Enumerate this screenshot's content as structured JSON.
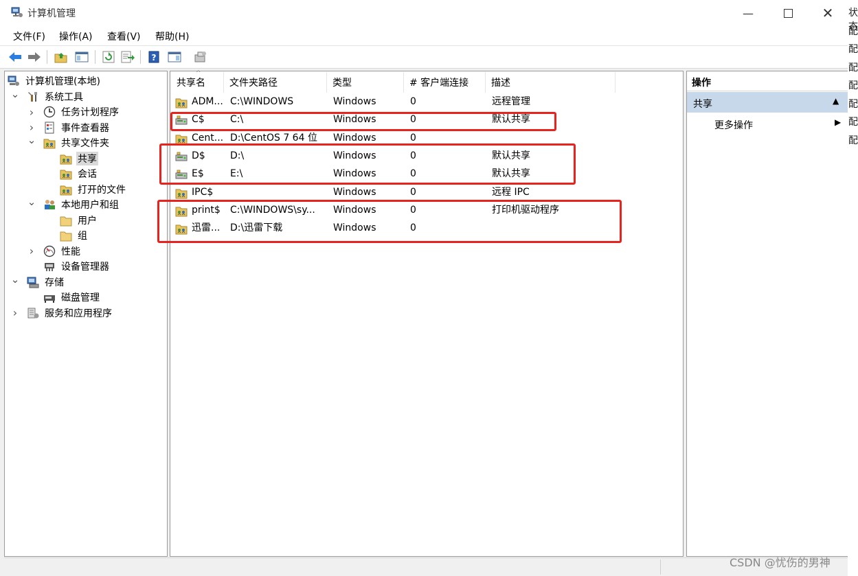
{
  "window": {
    "title": "计算机管理"
  },
  "menu": [
    "文件(F)",
    "操作(A)",
    "查看(V)",
    "帮助(H)"
  ],
  "tree": [
    {
      "label": "计算机管理(本地)",
      "level": 0,
      "toggle": "",
      "icon": "computer-management-icon"
    },
    {
      "label": "系统工具",
      "level": 1,
      "toggle": "⌄",
      "icon": "system-tools-icon"
    },
    {
      "label": "任务计划程序",
      "level": 2,
      "toggle": "›",
      "icon": "task-scheduler-icon"
    },
    {
      "label": "事件查看器",
      "level": 2,
      "toggle": "›",
      "icon": "event-viewer-icon"
    },
    {
      "label": "共享文件夹",
      "level": 2,
      "toggle": "⌄",
      "icon": "shared-folders-icon"
    },
    {
      "label": "共享",
      "level": 3,
      "toggle": "",
      "icon": "shares-icon",
      "selected": true
    },
    {
      "label": "会话",
      "level": 3,
      "toggle": "",
      "icon": "sessions-icon"
    },
    {
      "label": "打开的文件",
      "level": 3,
      "toggle": "",
      "icon": "open-files-icon"
    },
    {
      "label": "本地用户和组",
      "level": 2,
      "toggle": "⌄",
      "icon": "local-users-groups-icon"
    },
    {
      "label": "用户",
      "level": 3,
      "toggle": "",
      "icon": "users-folder-icon"
    },
    {
      "label": "组",
      "level": 3,
      "toggle": "",
      "icon": "groups-folder-icon"
    },
    {
      "label": "性能",
      "level": 2,
      "toggle": "›",
      "icon": "performance-icon"
    },
    {
      "label": "设备管理器",
      "level": 2,
      "toggle": "",
      "icon": "device-manager-icon"
    },
    {
      "label": "存储",
      "level": 1,
      "toggle": "⌄",
      "icon": "storage-icon"
    },
    {
      "label": "磁盘管理",
      "level": 2,
      "toggle": "",
      "icon": "disk-management-icon"
    },
    {
      "label": "服务和应用程序",
      "level": 1,
      "toggle": "›",
      "icon": "services-apps-icon"
    }
  ],
  "columns": [
    "共享名",
    "文件夹路径",
    "类型",
    "# 客户端连接",
    "描述"
  ],
  "rows": [
    {
      "name": "ADM...",
      "path": "C:\\WINDOWS",
      "type": "Windows",
      "clients": "0",
      "desc": "远程管理",
      "icon": "share-icon"
    },
    {
      "name": "C$",
      "path": "C:\\",
      "type": "Windows",
      "clients": "0",
      "desc": "默认共享",
      "icon": "drive-share-icon"
    },
    {
      "name": "Cent...",
      "path": "D:\\CentOS 7 64 位",
      "type": "Windows",
      "clients": "0",
      "desc": "",
      "icon": "share-icon"
    },
    {
      "name": "D$",
      "path": "D:\\",
      "type": "Windows",
      "clients": "0",
      "desc": "默认共享",
      "icon": "drive-share-icon"
    },
    {
      "name": "E$",
      "path": "E:\\",
      "type": "Windows",
      "clients": "0",
      "desc": "默认共享",
      "icon": "drive-share-icon"
    },
    {
      "name": "IPC$",
      "path": "",
      "type": "Windows",
      "clients": "0",
      "desc": "远程 IPC",
      "icon": "share-icon"
    },
    {
      "name": "print$",
      "path": "C:\\WINDOWS\\sy...",
      "type": "Windows",
      "clients": "0",
      "desc": "打印机驱动程序",
      "icon": "share-icon"
    },
    {
      "name": "迅雷...",
      "path": "D:\\迅雷下载",
      "type": "Windows",
      "clients": "0",
      "desc": "",
      "icon": "share-icon"
    }
  ],
  "actions": {
    "header": "操作",
    "section": "共享",
    "more": "更多操作"
  },
  "background_window_chars": [
    "状态",
    "配",
    "配",
    "配",
    "配",
    "配",
    "配",
    "配"
  ],
  "watermark": "CSDN @忧伤的男神",
  "colors": {
    "highlight": "#e8231e",
    "selection": "#d9d9d9",
    "action_section": "#c7d8ea"
  }
}
